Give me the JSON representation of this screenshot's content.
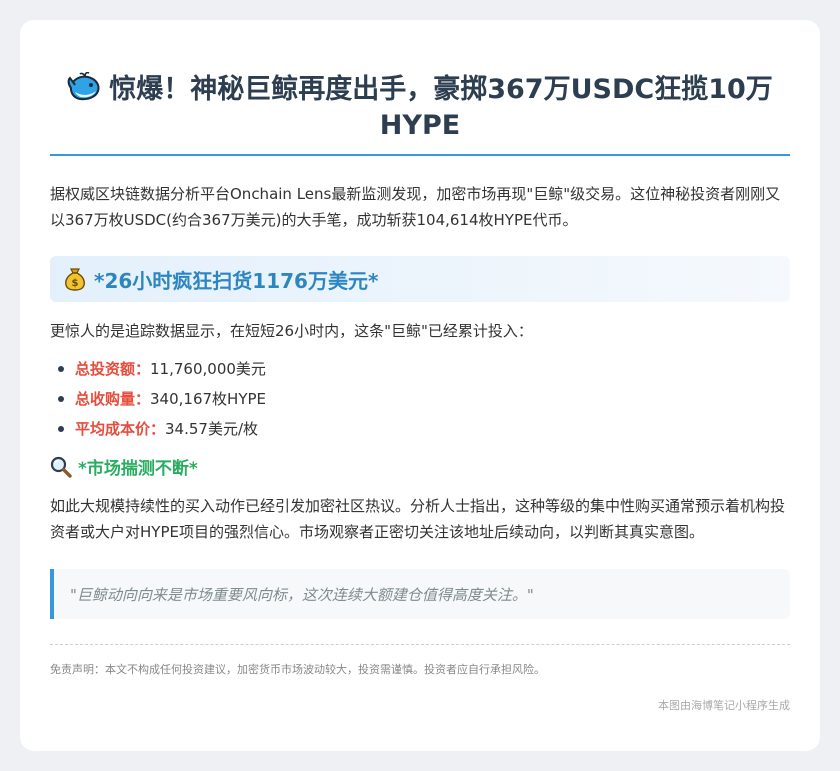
{
  "article": {
    "title": "惊爆！神秘巨鲸再度出手，豪掷367万USDC狂揽10万HYPE",
    "intro": "据权威区块链数据分析平台Onchain Lens最新监测发现，加密市场再现\"巨鲸\"级交易。这位神秘投资者刚刚又以367万枚USDC(约合367万美元)的大手笔，成功斩获104,614枚HYPE代币。",
    "section1": {
      "heading": "*26小时疯狂扫货1176万美元*",
      "lead": "更惊人的是追踪数据显示，在短短26小时内，这条\"巨鲸\"已经累计投入：",
      "stats": [
        {
          "label": "总投资额：",
          "value": "11,760,000美元"
        },
        {
          "label": "总收购量：",
          "value": "340,167枚HYPE"
        },
        {
          "label": "平均成本价：",
          "value": "34.57美元/枚"
        }
      ]
    },
    "section2": {
      "heading": "*市场揣测不断*",
      "body": "如此大规模持续性的买入动作已经引发加密社区热议。分析人士指出，这种等级的集中性购买通常预示着机构投资者或大户对HYPE项目的强烈信心。市场观察者正密切关注该地址后续动向，以判断其真实意图。"
    },
    "quote": "\"巨鲸动向向来是市场重要风向标，这次连续大额建仓值得高度关注。\"",
    "disclaimer": "免责声明：本文不构成任何投资建议，加密货币市场波动较大，投资需谨慎。投资者应自行承担风险。",
    "footer": "本图由海博笔记小程序生成"
  },
  "icons": {
    "title": "whale-icon",
    "section1": "money-bag-icon",
    "section2": "magnifying-glass-icon"
  },
  "colors": {
    "accent": "#3498db",
    "section_heading": "#2e86c1",
    "stat_label": "#e74c3c",
    "section2_heading": "#27ae60"
  }
}
